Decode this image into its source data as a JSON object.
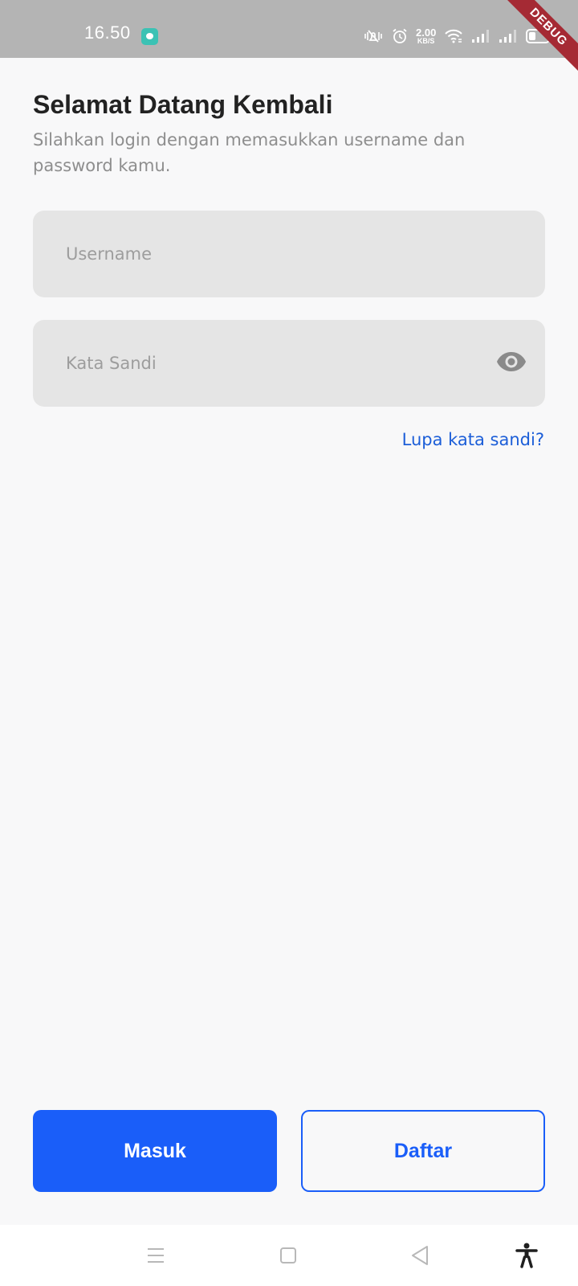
{
  "status_bar": {
    "time": "16.50",
    "net_speed_value": "2.00",
    "net_speed_unit": "KB/S",
    "icons": [
      "chat-app-icon",
      "vibrate-mute-icon",
      "alarm-icon",
      "wifi-icon",
      "signal-icon",
      "signal-icon",
      "battery-icon"
    ]
  },
  "debug_banner": "DEBUG",
  "header": {
    "title": "Selamat Datang Kembali",
    "subtitle": "Silahkan login dengan memasukkan username dan password kamu."
  },
  "form": {
    "username": {
      "placeholder": "Username",
      "value": ""
    },
    "password": {
      "placeholder": "Kata Sandi",
      "value": ""
    },
    "forgot_label": "Lupa kata sandi?"
  },
  "actions": {
    "login_label": "Masuk",
    "register_label": "Daftar"
  },
  "nav_bar": {
    "icons": [
      "menu-icon",
      "home-icon",
      "back-icon",
      "accessibility-icon"
    ]
  },
  "colors": {
    "accent": "#1a5ef9",
    "link": "#1c5ed8",
    "field_bg": "#e5e5e5",
    "status_bar_bg": "#b4b4b4",
    "debug_ribbon": "#a52a34"
  }
}
